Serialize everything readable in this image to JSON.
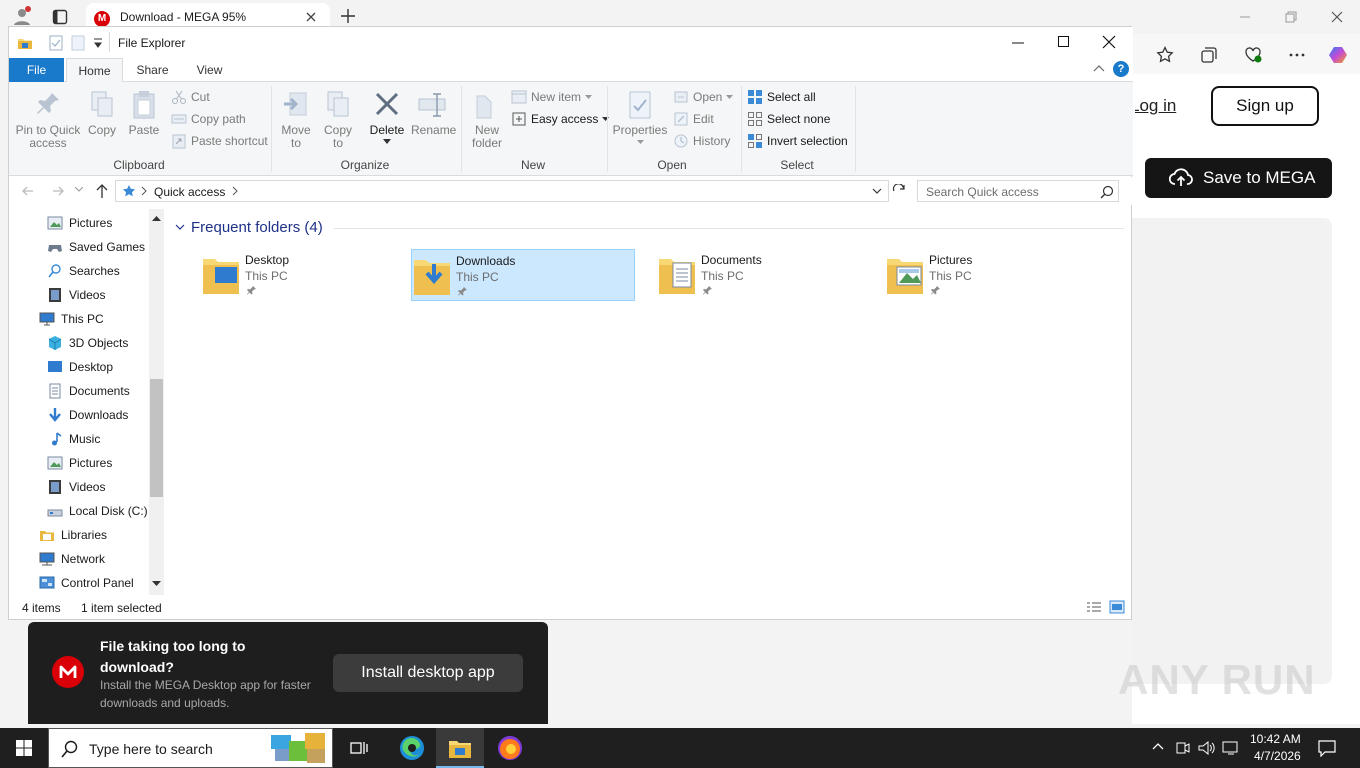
{
  "browser": {
    "tab_title": "Download - MEGA 95%"
  },
  "window": {
    "title": "File Explorer"
  },
  "ribbon": {
    "tabs": {
      "file": "File",
      "home": "Home",
      "share": "Share",
      "view": "View"
    },
    "clipboard": {
      "pin": "Pin to Quick access",
      "copy": "Copy",
      "paste": "Paste",
      "cut": "Cut",
      "copy_path": "Copy path",
      "paste_shortcut": "Paste shortcut",
      "label": "Clipboard"
    },
    "organize": {
      "move_to": "Move to",
      "copy_to": "Copy to",
      "delete": "Delete",
      "rename": "Rename",
      "label": "Organize"
    },
    "new": {
      "new_folder": "New folder",
      "new_item": "New item",
      "easy_access": "Easy access",
      "label": "New"
    },
    "open": {
      "properties": "Properties",
      "open": "Open",
      "edit": "Edit",
      "history": "History",
      "label": "Open"
    },
    "select": {
      "select_all": "Select all",
      "select_none": "Select none",
      "invert_selection": "Invert selection",
      "label": "Select"
    }
  },
  "address": {
    "path": "Quick access",
    "search_placeholder": "Search Quick access"
  },
  "nav": {
    "items": [
      {
        "label": "Pictures",
        "icon": "pictures-icon"
      },
      {
        "label": "Saved Games",
        "icon": "saved-games-icon"
      },
      {
        "label": "Searches",
        "icon": "search-folder-icon"
      },
      {
        "label": "Videos",
        "icon": "videos-icon"
      },
      {
        "label": "This PC",
        "icon": "this-pc-icon"
      },
      {
        "label": "3D Objects",
        "icon": "3d-objects-icon"
      },
      {
        "label": "Desktop",
        "icon": "desktop-icon"
      },
      {
        "label": "Documents",
        "icon": "documents-icon"
      },
      {
        "label": "Downloads",
        "icon": "downloads-icon"
      },
      {
        "label": "Music",
        "icon": "music-icon"
      },
      {
        "label": "Pictures",
        "icon": "pictures-icon"
      },
      {
        "label": "Videos",
        "icon": "videos-icon"
      },
      {
        "label": "Local Disk (C:)",
        "icon": "drive-icon"
      },
      {
        "label": "Libraries",
        "icon": "libraries-icon"
      },
      {
        "label": "Network",
        "icon": "network-icon"
      },
      {
        "label": "Control Panel",
        "icon": "control-panel-icon"
      }
    ]
  },
  "content": {
    "group_header": "Frequent folders (4)",
    "folders": [
      {
        "name": "Desktop",
        "location": "This PC"
      },
      {
        "name": "Downloads",
        "location": "This PC"
      },
      {
        "name": "Documents",
        "location": "This PC"
      },
      {
        "name": "Pictures",
        "location": "This PC"
      }
    ]
  },
  "status": {
    "items": "4 items",
    "selected": "1 item selected"
  },
  "mega": {
    "login": "Log in",
    "signup": "Sign up",
    "save": "Save to MEGA",
    "toast_title": "File taking too long to download?",
    "toast_body": "Install the MEGA Desktop app for faster downloads and uploads.",
    "toast_button": "Install desktop app"
  },
  "watermark": "ANY RUN",
  "taskbar": {
    "search_placeholder": "Type here to search",
    "time": "10:42 AM",
    "date": "4/7/2026"
  },
  "colors": {
    "accent": "#1979ca",
    "selection": "#cce8ff",
    "mega_red": "#d90007"
  }
}
